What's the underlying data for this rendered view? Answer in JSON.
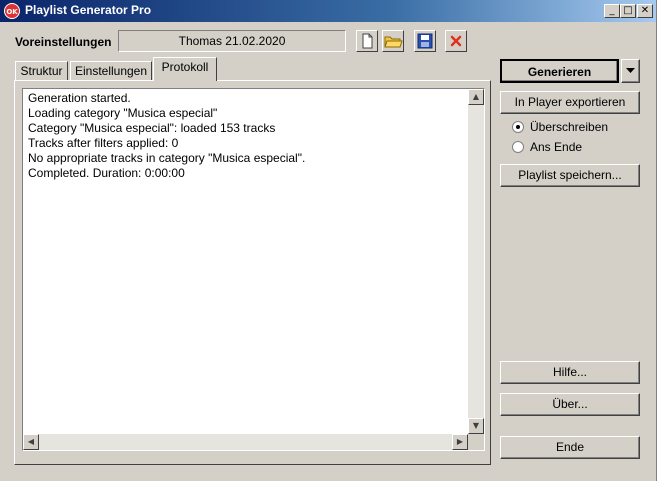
{
  "window": {
    "title": "Playlist Generator Pro",
    "icon_text": "OK",
    "controls": {
      "minimize": "_",
      "maximize": "□",
      "close": "✕"
    }
  },
  "preset": {
    "label": "Voreinstellungen",
    "value": "Thomas 21.02.2020"
  },
  "toolbar_icons": [
    "new-file-icon",
    "open-folder-icon",
    "save-disk-icon",
    "delete-x-icon"
  ],
  "tabs": [
    {
      "label": "Struktur",
      "active": false
    },
    {
      "label": "Einstellungen",
      "active": false
    },
    {
      "label": "Protokoll",
      "active": true
    }
  ],
  "log_lines": [
    "Generation started.",
    "Loading category \"Musica especial\"",
    "Category \"Musica especial\": loaded 153 tracks",
    "Tracks after filters applied: 0",
    "No appropriate tracks in category \"Musica especial\".",
    "Completed. Duration: 0:00:00"
  ],
  "right_panel": {
    "generate_label": "Generieren",
    "export_label": "In Player exportieren",
    "radio_overwrite": "Überschreiben",
    "radio_append": "Ans Ende",
    "radio_selected": "overwrite",
    "save_playlist_label": "Playlist speichern...",
    "help_label": "Hilfe...",
    "about_label": "Über...",
    "exit_label": "Ende"
  }
}
